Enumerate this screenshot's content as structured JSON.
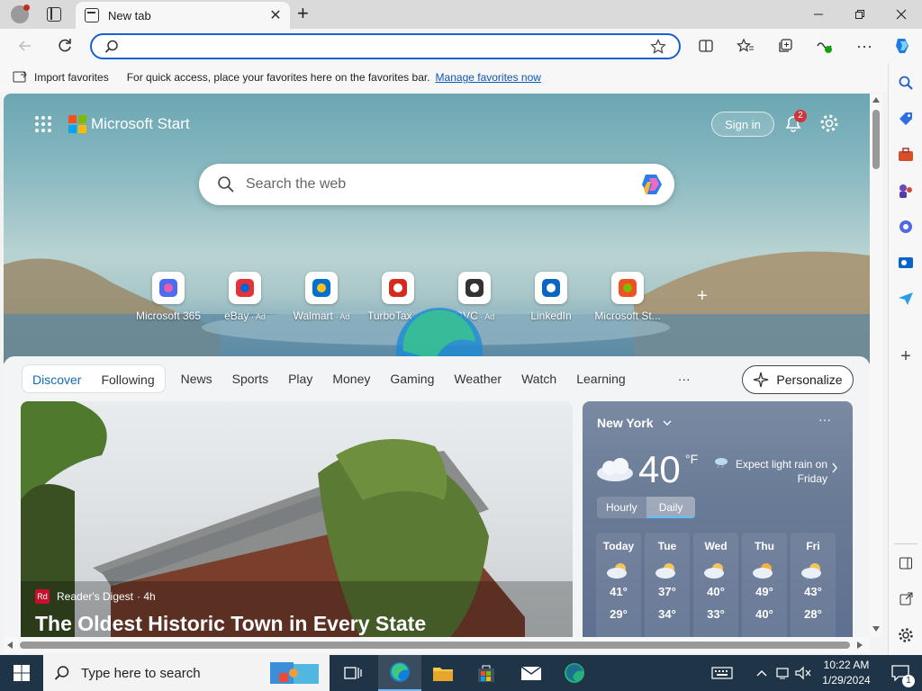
{
  "browser": {
    "tab_title": "New tab",
    "address_value": "",
    "favorites_bar": {
      "import_label": "Import favorites",
      "message": "For quick access, place your favorites here on the favorites bar.",
      "manage_link": "Manage favorites now"
    }
  },
  "start": {
    "brand": "Microsoft Start",
    "sign_in": "Sign in",
    "notification_count": "2",
    "search_placeholder": "Search the web",
    "quick_links": [
      {
        "label": "Microsoft 365",
        "ad": "",
        "icon": "microsoft-365-icon"
      },
      {
        "label": "eBay",
        "ad": "Ad",
        "icon": "ebay-icon"
      },
      {
        "label": "Walmart",
        "ad": "Ad",
        "icon": "walmart-icon"
      },
      {
        "label": "TurboTax",
        "ad": "Ad",
        "icon": "turbotax-icon"
      },
      {
        "label": "QVC",
        "ad": "Ad",
        "icon": "qvc-icon"
      },
      {
        "label": "LinkedIn",
        "ad": "",
        "icon": "linkedin-icon"
      },
      {
        "label": "Microsoft St...",
        "ad": "",
        "icon": "microsoft-store-icon"
      }
    ],
    "nav": {
      "discover": "Discover",
      "following": "Following",
      "tabs": [
        "News",
        "Sports",
        "Play",
        "Money",
        "Gaming",
        "Weather",
        "Watch",
        "Learning"
      ],
      "more": "···",
      "personalize": "Personalize"
    },
    "article": {
      "source": "Reader's Digest",
      "age": "· 4h",
      "headline": "The Oldest Historic Town in Every State"
    },
    "weather": {
      "city": "New York",
      "temp": "40",
      "unit": "°F",
      "alert": "Expect light rain on Friday",
      "toggle_hourly": "Hourly",
      "toggle_daily": "Daily",
      "days": [
        {
          "name": "Today",
          "hi": "41°",
          "lo": "29°"
        },
        {
          "name": "Tue",
          "hi": "37°",
          "lo": "34°"
        },
        {
          "name": "Wed",
          "hi": "40°",
          "lo": "33°"
        },
        {
          "name": "Thu",
          "hi": "49°",
          "lo": "40°"
        },
        {
          "name": "Fri",
          "hi": "43°",
          "lo": "28°"
        }
      ]
    }
  },
  "taskbar": {
    "search_placeholder": "Type here to search",
    "time": "10:22 AM",
    "date": "1/29/2024",
    "notification_badge": "1"
  },
  "colors": {
    "accent": "#0f6cbd",
    "taskbar": "#1f3447"
  }
}
